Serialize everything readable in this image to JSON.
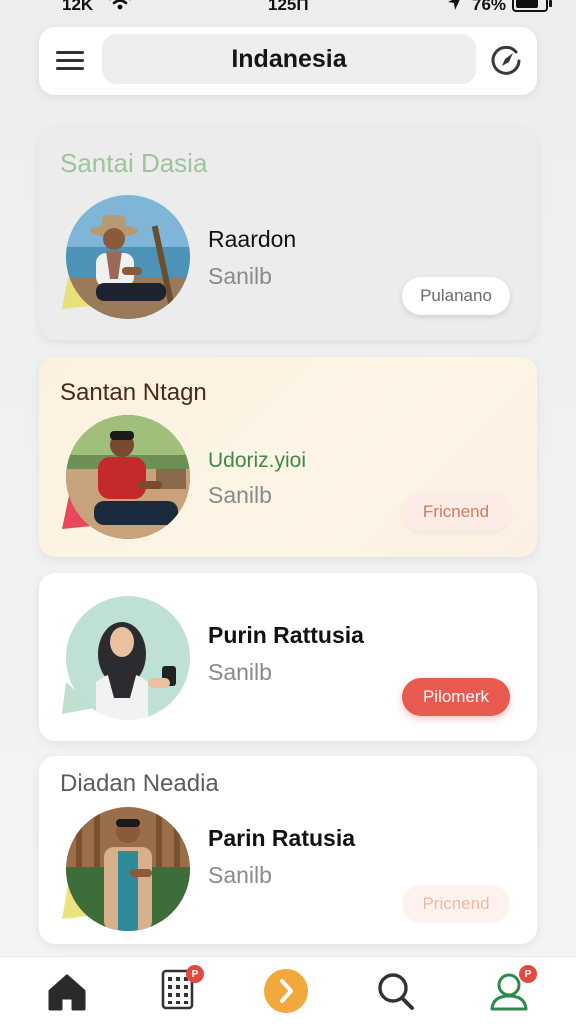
{
  "status_bar": {
    "signal": "12K",
    "time": "125П",
    "battery": "76%"
  },
  "header": {
    "title": "Indanesia",
    "menu_icon": "hamburger-menu-icon",
    "action_icon": "compass-icon"
  },
  "cards": [
    {
      "heading": "Santai Dasia",
      "name": "Raardon",
      "subtitle": "Sanilb",
      "button": "Pulanano",
      "accent": "#9dc49a"
    },
    {
      "heading": "Santan Ntagn",
      "name": "Udoriz.yioi",
      "subtitle": "Sanilb",
      "button": "Fricnend",
      "accent": "#3f8a4a"
    },
    {
      "heading": "",
      "name": "Purin Rattusia",
      "subtitle": "Sanilb",
      "button": "Pilomerk",
      "accent": "#e85a4f"
    },
    {
      "heading": "Diadan Neadia",
      "name": "Parin Ratusia",
      "subtitle": "Sanilb",
      "button": "Pricnend",
      "accent": "#efb9a2"
    }
  ],
  "bottom_nav": {
    "items": [
      {
        "icon": "home-icon"
      },
      {
        "icon": "grid-calendar-icon",
        "badge": "P"
      },
      {
        "icon": "next-arrow-icon"
      },
      {
        "icon": "search-icon"
      },
      {
        "icon": "profile-icon",
        "badge": "P"
      }
    ],
    "active_color": "#f2a93b"
  }
}
